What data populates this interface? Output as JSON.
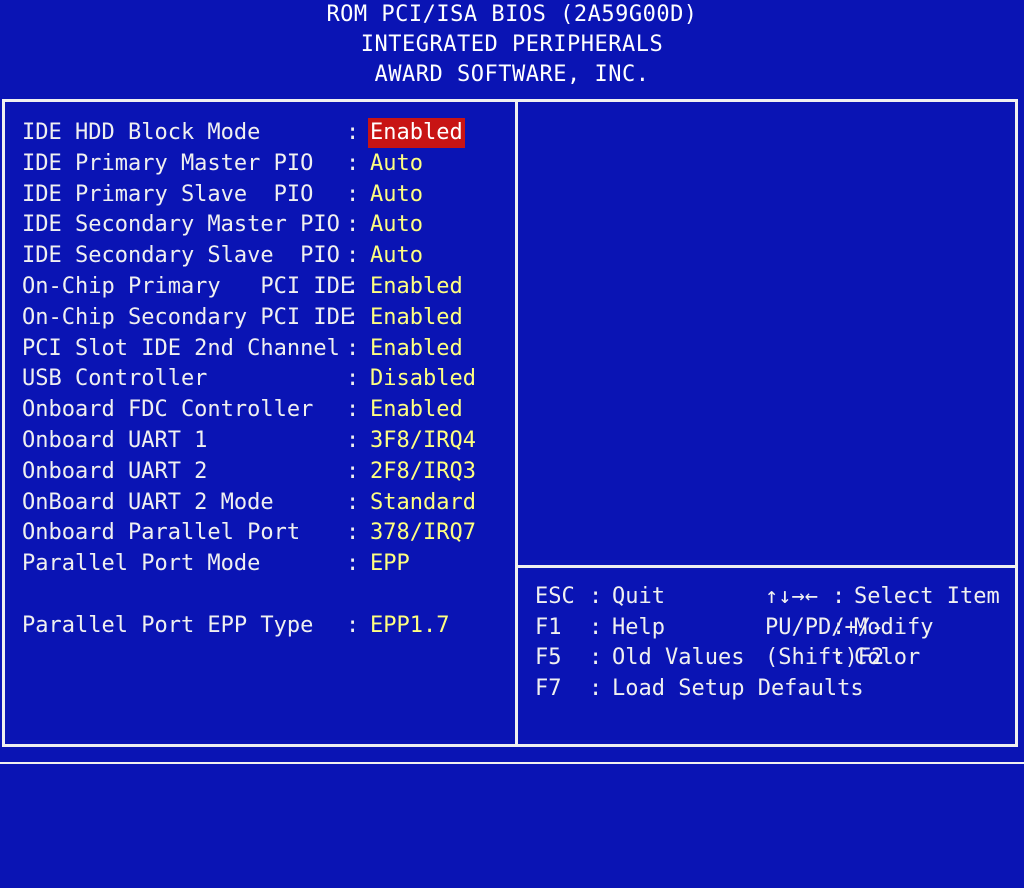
{
  "header": {
    "line1": "ROM PCI/ISA BIOS (2A59G00D)",
    "line2": "INTEGRATED PERIPHERALS",
    "line3": "AWARD SOFTWARE, INC."
  },
  "settings": [
    {
      "label": "IDE HDD Block Mode",
      "value": "Enabled",
      "selected": true
    },
    {
      "label": "IDE Primary Master PIO",
      "value": "Auto"
    },
    {
      "label": "IDE Primary Slave  PIO",
      "value": "Auto"
    },
    {
      "label": "IDE Secondary Master PIO",
      "value": "Auto"
    },
    {
      "label": "IDE Secondary Slave  PIO",
      "value": "Auto"
    },
    {
      "label": "On-Chip Primary   PCI IDE",
      "value": "Enabled"
    },
    {
      "label": "On-Chip Secondary PCI IDE",
      "value": "Enabled"
    },
    {
      "label": "PCI Slot IDE 2nd Channel",
      "value": "Enabled"
    },
    {
      "label": "USB Controller",
      "value": "Disabled"
    },
    {
      "label": "Onboard FDC Controller",
      "value": "Enabled"
    },
    {
      "label": "Onboard UART 1",
      "value": "3F8/IRQ4"
    },
    {
      "label": "Onboard UART 2",
      "value": "2F8/IRQ3"
    },
    {
      "label": "OnBoard UART 2 Mode",
      "value": "Standard"
    },
    {
      "label": "Onboard Parallel Port",
      "value": "378/IRQ7"
    },
    {
      "label": "Parallel Port Mode",
      "value": "EPP"
    },
    {
      "label": "",
      "value": ""
    },
    {
      "label": "Parallel Port EPP Type",
      "value": "EPP1.7"
    }
  ],
  "separator": ":",
  "help": {
    "rows": [
      {
        "key1": "ESC",
        "action1": "Quit",
        "key2": "↑↓→←",
        "action2": "Select Item"
      },
      {
        "key1": "F1",
        "action1": "Help",
        "key2": "PU/PD/+/-",
        "action2": "Modify"
      },
      {
        "key1": "F5",
        "action1": "Old Values",
        "key2": "(Shift)F2",
        "action2": "Color"
      },
      {
        "key1": "F7",
        "action1": "Load Setup Defaults",
        "key2": "",
        "action2": ""
      }
    ]
  },
  "colors": {
    "background": "#0a14b4",
    "text": "#f0f0f0",
    "value_text": "#ffff80",
    "highlight": "#c81414"
  }
}
